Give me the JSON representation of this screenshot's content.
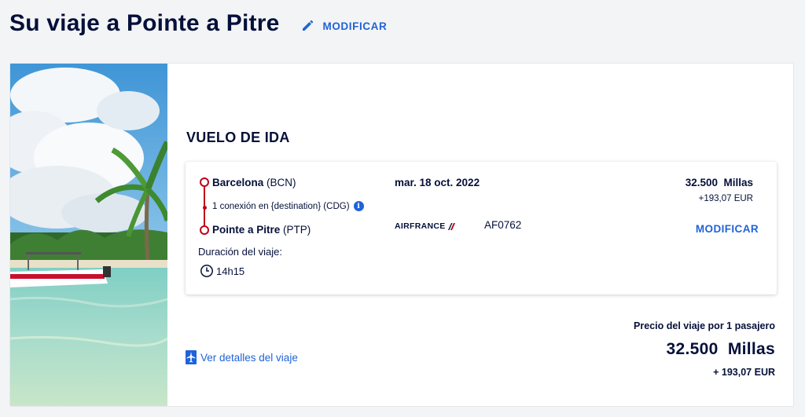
{
  "header": {
    "title": "Su viaje a Pointe a Pitre",
    "modify_label": "MODIFICAR"
  },
  "section": {
    "title": "VUELO DE IDA"
  },
  "flight": {
    "origin_city": "Barcelona",
    "origin_code": "(BCN)",
    "connection_text": "1 conexión en {destination} (CDG)",
    "destination_city": "Pointe a Pitre",
    "destination_code": "(PTP)",
    "duration_label": "Duración del viaje:",
    "duration": "14h15",
    "date": "mar. 18 oct. 2022",
    "airline": "AIRFRANCE",
    "flight_number": "AF0762",
    "price_miles": "32.500  Millas",
    "price_eur": "+193,07 EUR",
    "modify_label": "MODIFICAR"
  },
  "details_link": "Ver detalles del viaje",
  "total": {
    "label": "Precio del viaje por 1 pasajero",
    "miles": "32.500  Millas",
    "eur": "+ 193,07 EUR"
  },
  "colors": {
    "brand_navy": "#051039",
    "link_blue": "#1f63d8",
    "route_red": "#c00018",
    "page_bg": "#f3f4f6"
  },
  "icons": [
    "pencil-icon",
    "info-icon",
    "clock-icon",
    "plane-details-icon",
    "airline-logo"
  ]
}
